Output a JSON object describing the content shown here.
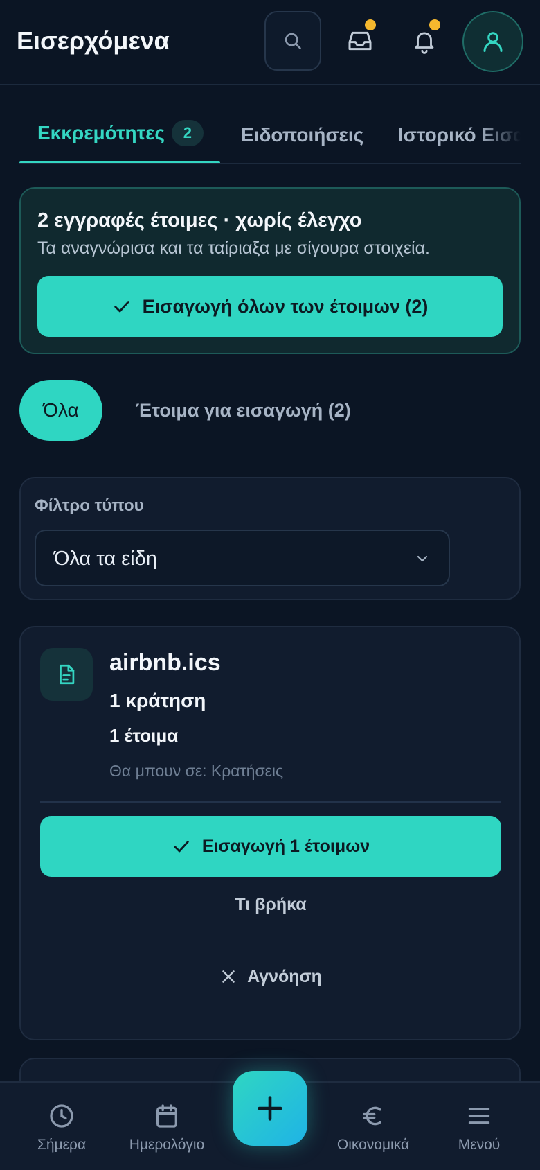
{
  "header": {
    "title": "Εισερχόμενα",
    "icons": {
      "search": "search-icon",
      "inbox": "inbox-icon",
      "bell": "bell-icon",
      "avatar": "user-icon"
    }
  },
  "tabs": [
    {
      "label": "Εκκρεμότητες",
      "badge": "2",
      "active": true
    },
    {
      "label": "Ειδοποιήσεις",
      "active": false
    },
    {
      "label": "Ιστορικό Εισαγωγών",
      "active": false
    }
  ],
  "ready_banner": {
    "title": "2 εγγραφές έτοιμες · χωρίς έλεγχο",
    "subtitle": "Τα αναγνώρισα και τα ταίριαξα με σίγουρα στοιχεία.",
    "button_label": "Εισαγωγή όλων των έτοιμων (2)"
  },
  "chips": {
    "all": "Όλα",
    "ready": "Έτοιμα για εισαγωγή (2)"
  },
  "filter": {
    "label": "Φίλτρο τύπου",
    "selected": "Όλα τα είδη"
  },
  "file_card": {
    "name": "airbnb.ics",
    "count": "1 κράτηση",
    "ready": "1 έτοιμα",
    "destination": "Θα μπουν σε: Κρατήσεις",
    "import_label": "Εισαγωγή 1 έτοιμων",
    "details_label": "Τι βρήκα",
    "ignore_label": "Αγνόηση"
  },
  "bottom_nav": {
    "today": "Σήμερα",
    "calendar": "Ημερολόγιο",
    "finance": "Οικονομικά",
    "menu": "Μενού"
  },
  "colors": {
    "accent": "#2fd6c2",
    "background": "#0b1524",
    "card": "#111c2e",
    "notification_dot": "#f5b82e"
  }
}
